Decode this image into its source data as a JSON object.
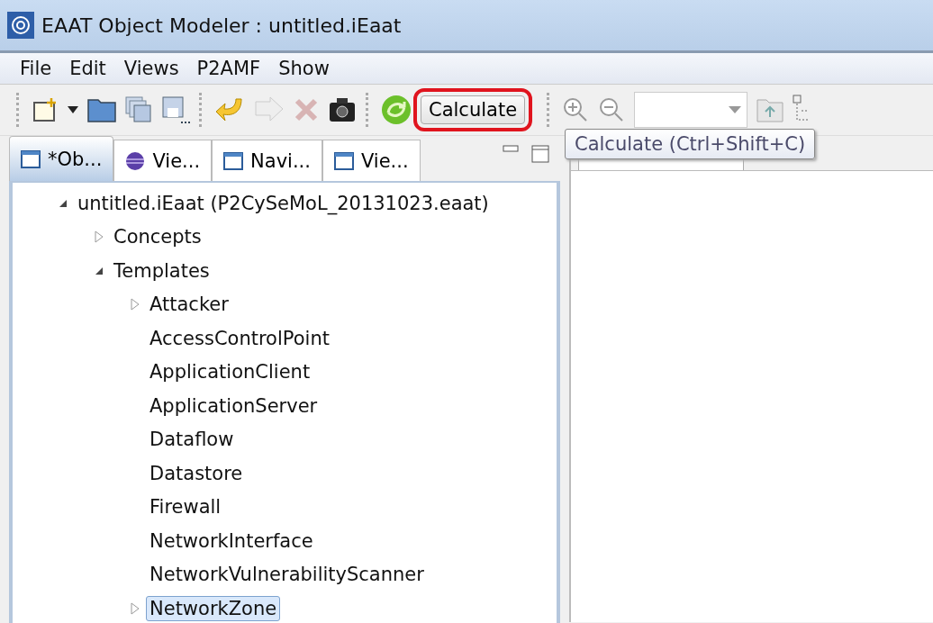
{
  "window": {
    "title": "EAAT Object Modeler : untitled.iEaat"
  },
  "menu": [
    "File",
    "Edit",
    "Views",
    "P2AMF",
    "Show"
  ],
  "toolbar": {
    "calculate_button": "Calculate",
    "tooltip": "Calculate (Ctrl+Shift+C)"
  },
  "tabs": [
    {
      "label": "*Ob...",
      "kind": "window",
      "selected": true
    },
    {
      "label": "Vie...",
      "kind": "globe",
      "selected": false
    },
    {
      "label": "Navi...",
      "kind": "window",
      "selected": false
    },
    {
      "label": "Vie...",
      "kind": "window",
      "selected": false
    }
  ],
  "tree": [
    {
      "label": "untitled.iEaat (P2CySeMoL_20131023.eaat)",
      "expanded": true,
      "selected": false,
      "children": [
        {
          "label": "Concepts",
          "expanded": false,
          "selected": false
        },
        {
          "label": "Templates",
          "expanded": true,
          "selected": false,
          "children": [
            {
              "label": "Attacker",
              "expanded": false,
              "selected": false
            },
            {
              "label": "AccessControlPoint",
              "selected": false
            },
            {
              "label": "ApplicationClient",
              "selected": false
            },
            {
              "label": "ApplicationServer",
              "selected": false
            },
            {
              "label": "Dataflow",
              "selected": false
            },
            {
              "label": "Datastore",
              "selected": false
            },
            {
              "label": "Firewall",
              "selected": false
            },
            {
              "label": "NetworkInterface",
              "selected": false
            },
            {
              "label": "NetworkVulnerabilityScanner",
              "selected": false
            },
            {
              "label": "NetworkZone",
              "expanded": false,
              "selected": true
            }
          ]
        }
      ]
    }
  ]
}
